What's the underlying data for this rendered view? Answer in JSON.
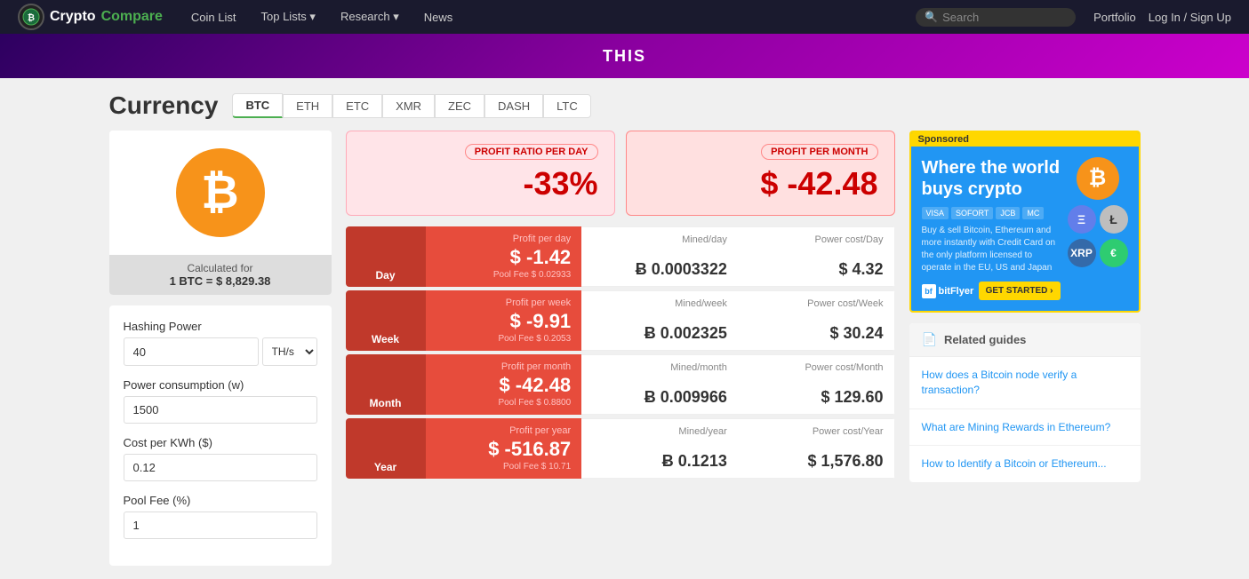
{
  "nav": {
    "logo_crypto": "Crypto",
    "logo_compare": "Compare",
    "links": [
      {
        "label": "Coin List",
        "has_arrow": false
      },
      {
        "label": "Top Lists",
        "has_arrow": true
      },
      {
        "label": "Research",
        "has_arrow": true
      },
      {
        "label": "News",
        "has_arrow": false
      }
    ],
    "search_placeholder": "Search",
    "portfolio": "Portfolio",
    "login": "Log In / Sign Up"
  },
  "currency": {
    "title": "Currency",
    "tabs": [
      "BTC",
      "ETH",
      "ETC",
      "XMR",
      "ZEC",
      "DASH",
      "LTC"
    ],
    "active_tab": "BTC",
    "calc_for": "Calculated for",
    "btc_value": "1 BTC = $ 8,829.38"
  },
  "form": {
    "hashing_power_label": "Hashing Power",
    "hashing_power_value": "40",
    "hashing_unit": "TH/s",
    "power_consumption_label": "Power consumption (w)",
    "power_consumption_value": "1500",
    "cost_per_kwh_label": "Cost per KWh ($)",
    "cost_per_kwh_value": "0.12",
    "pool_fee_label": "Pool Fee (%)",
    "pool_fee_value": "1"
  },
  "profit_summary": {
    "day_label": "PROFIT RATIO PER DAY",
    "day_value": "-33%",
    "month_label": "PROFIT PER MONTH",
    "month_value": "$ -42.48"
  },
  "data_rows": [
    {
      "period": "Day",
      "profit_label": "Profit per day",
      "profit_value": "$ -1.42",
      "pool_fee": "Pool Fee $ 0.02933",
      "mined_label": "Mined/day",
      "mined_value": "Ƀ 0.0003322",
      "power_label": "Power cost/Day",
      "power_value": "$ 4.32"
    },
    {
      "period": "Week",
      "profit_label": "Profit per week",
      "profit_value": "$ -9.91",
      "pool_fee": "Pool Fee $ 0.2053",
      "mined_label": "Mined/week",
      "mined_value": "Ƀ 0.002325",
      "power_label": "Power cost/Week",
      "power_value": "$ 30.24"
    },
    {
      "period": "Month",
      "profit_label": "Profit per month",
      "profit_value": "$ -42.48",
      "pool_fee": "Pool Fee $ 0.8800",
      "mined_label": "Mined/month",
      "mined_value": "Ƀ 0.009966",
      "power_label": "Power cost/Month",
      "power_value": "$ 129.60"
    },
    {
      "period": "Year",
      "profit_label": "Profit per year",
      "profit_value": "$ -516.87",
      "pool_fee": "Pool Fee $ 10.71",
      "mined_label": "Mined/year",
      "mined_value": "Ƀ 0.1213",
      "power_label": "Power cost/Year",
      "power_value": "$ 1,576.80"
    }
  ],
  "ad": {
    "sponsored": "Sponsored",
    "headline": "Where the world buys crypto",
    "payment_icons": [
      "VISA",
      "SOFORT",
      "JCB",
      "MC"
    ],
    "description": "Buy & sell Bitcoin, Ethereum and more instantly with Credit Card on the only platform licensed to operate in the EU, US and Japan",
    "logo": "bitFlyer",
    "cta": "GET STARTED ›"
  },
  "related_guides": {
    "header": "Related guides",
    "items": [
      "How does a Bitcoin node verify a transaction?",
      "What are Mining Rewards in Ethereum?",
      "How to Identify a Bitcoin or Ethereum..."
    ]
  }
}
